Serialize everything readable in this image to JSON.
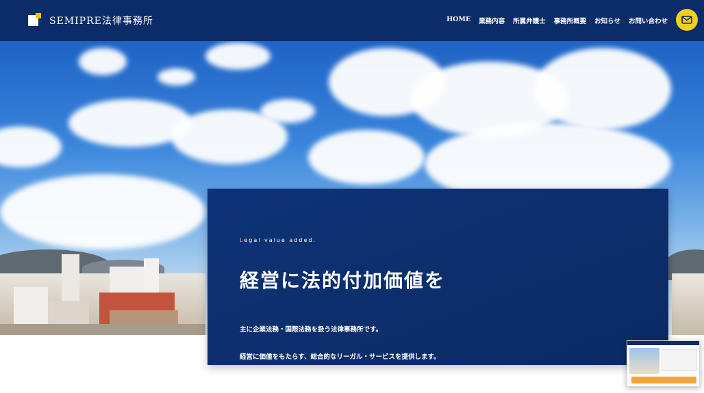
{
  "header": {
    "brand": "SEMIPRE法律事務所",
    "nav": [
      "HOME",
      "業務内容",
      "所属弁護士",
      "事務所概要",
      "お知らせ",
      "お問い合わせ"
    ],
    "mail_icon": "envelope-icon"
  },
  "hero": {
    "tagline_first": "L",
    "tagline_rest": "egal value added.",
    "headline": "経営に法的付加価値を",
    "description_1": "主に企業法務・国際法務を扱う法律事務所です。",
    "description_2": "経営に価値をもたらす、総合的なリーガル・サービスを提供します。"
  },
  "colors": {
    "header_bg": "#0b2c68",
    "accent_yellow": "#f2cf1c",
    "content_box_bg": "#0e3377"
  }
}
